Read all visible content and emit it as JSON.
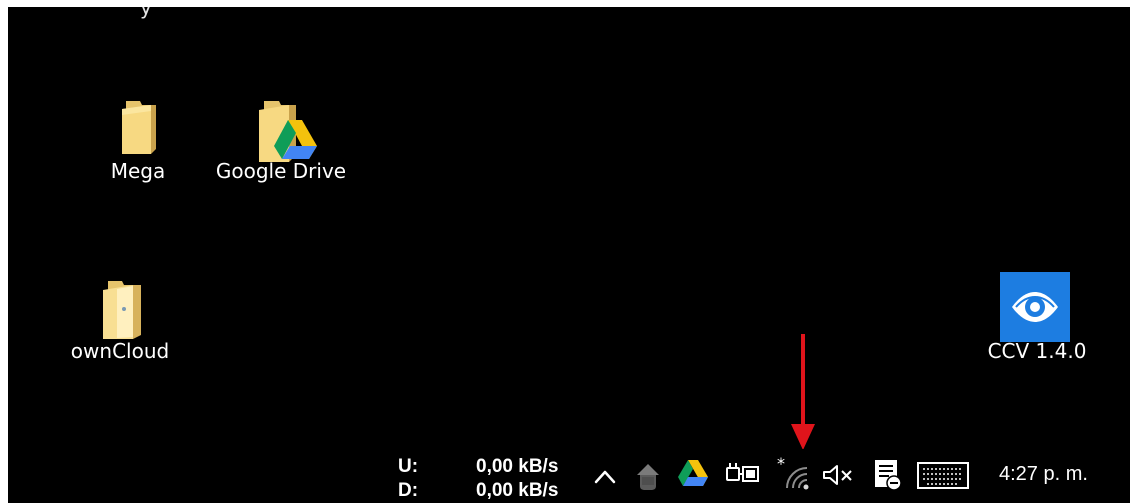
{
  "desktop": {
    "partial_label": "y",
    "icons": [
      {
        "label": "Mega",
        "icon": "folder-icon"
      },
      {
        "label": "Google Drive",
        "icon": "google-drive-folder-icon"
      },
      {
        "label": "ownCloud",
        "icon": "owncloud-folder-icon"
      },
      {
        "label": "CCV 1.4.0",
        "icon": "eye-icon"
      }
    ]
  },
  "taskbar": {
    "network_meter": {
      "upload_label": "U:",
      "download_label": "D:",
      "upload_value": "0,00 kB/s",
      "download_value": "0,00 kB/s"
    },
    "tray_icons": [
      "chevron-up-icon",
      "cloud-icon",
      "google-drive-icon",
      "power-plug-icon",
      "wifi-icon",
      "speaker-muted-icon",
      "notification-icon",
      "keyboard-icon"
    ],
    "clock": "4:27 p. m."
  },
  "annotation": {
    "color": "#e0141b",
    "target": "wifi-icon"
  }
}
